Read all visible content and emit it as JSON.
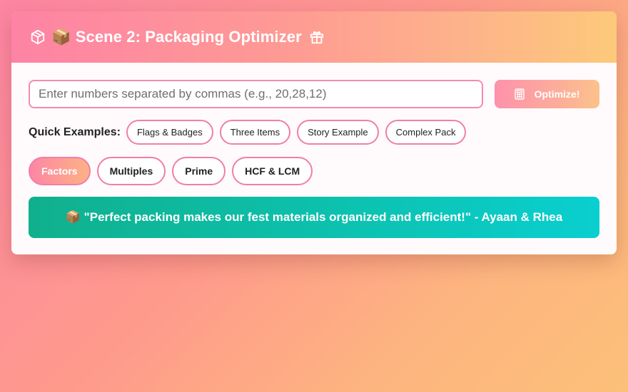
{
  "header": {
    "title": "📦 Scene 2: Packaging Optimizer",
    "icon": "cube-icon",
    "trailing_icon": "gift-icon"
  },
  "input": {
    "placeholder": "Enter numbers separated by commas (e.g., 20,28,12)",
    "value": ""
  },
  "optimize_button": {
    "label": "Optimize!",
    "icon": "calculator-icon"
  },
  "quick_examples": {
    "label": "Quick Examples:",
    "items": [
      "Flags & Badges",
      "Three Items",
      "Story Example",
      "Complex Pack"
    ]
  },
  "tabs": {
    "active": "Factors",
    "items": [
      "Factors",
      "Multiples",
      "Prime",
      "HCF & LCM"
    ]
  },
  "quote": {
    "text": "📦 \"Perfect packing makes our fest materials organized and efficient!\" - Ayaan & Rhea"
  },
  "colors": {
    "accent_pink": "#f07eaa",
    "header_start": "#fe83a5",
    "header_end": "#fdc97a",
    "quote_start": "#10b08d",
    "quote_end": "#0acfd0"
  }
}
